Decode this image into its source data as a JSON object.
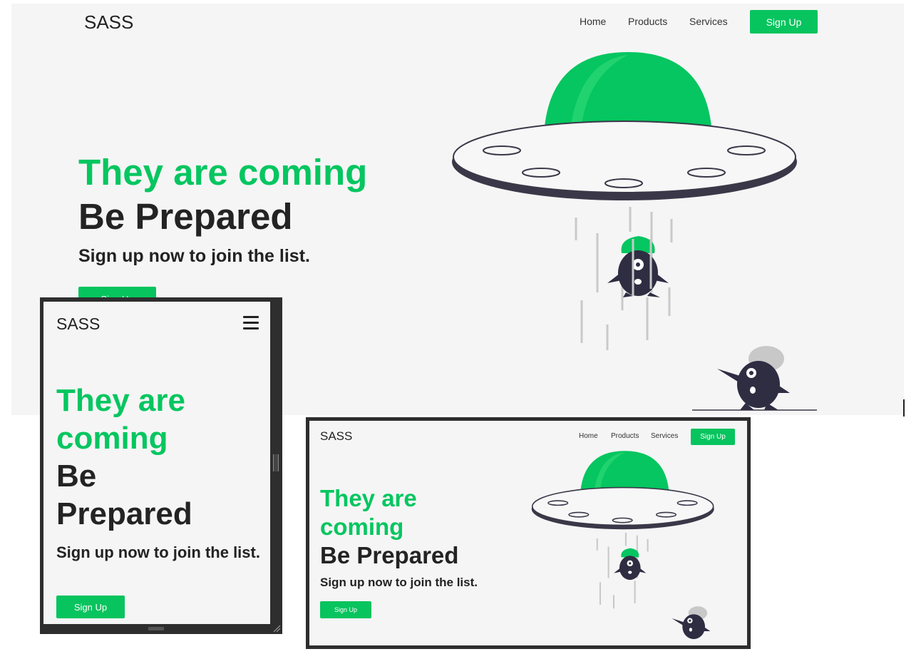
{
  "colors": {
    "accent": "#07c45e",
    "dark": "#232323",
    "background": "#f5f5f5",
    "frame": "#2e2e2e"
  },
  "desktop": {
    "logo": "SASS",
    "nav": [
      "Home",
      "Products",
      "Services"
    ],
    "signup_button": "Sign Up",
    "headline_green": "They are coming",
    "headline_dark": "Be Prepared",
    "subtitle": "Sign up now to join the list.",
    "hero_button": "Sign Up"
  },
  "mobile": {
    "logo": "SASS",
    "menu_icon": "hamburger-menu-icon",
    "headline_green_1": "They are",
    "headline_green_2": "coming",
    "headline_dark_1": "Be",
    "headline_dark_2": "Prepared",
    "subtitle": "Sign up now to join the list.",
    "hero_button": "Sign Up"
  },
  "tablet": {
    "logo": "SASS",
    "nav": [
      "Home",
      "Products",
      "Services"
    ],
    "signup_button": "Sign Up",
    "headline_green_1": "They are",
    "headline_green_2": "coming",
    "headline_dark": "Be Prepared",
    "subtitle": "Sign up now to join the list.",
    "hero_button": "Sign Up"
  },
  "illustration": "ufo-abduction-illustration"
}
